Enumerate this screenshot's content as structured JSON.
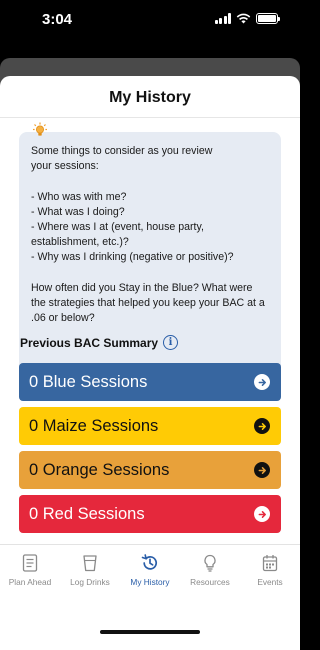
{
  "status_bar": {
    "time": "3:04"
  },
  "header": {
    "title": "My History"
  },
  "tips": {
    "text": "Some things to consider as you review\nyour sessions:\n\n- Who was with me?\n- What was I doing?\n- Where was I at (event, house party,\nestablishment, etc.)?\n- Why was I drinking (negative or positive)?\n\nHow often did you Stay in the Blue? What were\nthe strategies that helped you keep your BAC at a\n.06 or below?"
  },
  "summary": {
    "title": "Previous BAC Summary"
  },
  "sessions": [
    {
      "label": "0 Blue Sessions",
      "bg": "#3766a0",
      "fg": "#ffffff",
      "arrow_bg": "#ffffff",
      "arrow_fg": "#3766a0"
    },
    {
      "label": "0 Maize Sessions",
      "bg": "#ffcb05",
      "fg": "#111111",
      "arrow_bg": "#111111",
      "arrow_fg": "#ffcb05"
    },
    {
      "label": "0 Orange Sessions",
      "bg": "#e8a13a",
      "fg": "#111111",
      "arrow_bg": "#111111",
      "arrow_fg": "#e8a13a"
    },
    {
      "label": "0 Red Sessions",
      "bg": "#e5283c",
      "fg": "#ffffff",
      "arrow_bg": "#ffffff",
      "arrow_fg": "#e5283c"
    }
  ],
  "tabs": [
    {
      "label": "Plan Ahead",
      "icon": "checklist-icon"
    },
    {
      "label": "Log Drinks",
      "icon": "cup-icon"
    },
    {
      "label": "My History",
      "icon": "history-icon",
      "active": true
    },
    {
      "label": "Resources",
      "icon": "lightbulb-icon"
    },
    {
      "label": "Events",
      "icon": "calendar-icon"
    }
  ],
  "colors": {
    "accent": "#2a5ea8",
    "tab_inactive": "#8a8a8a",
    "card_bg": "#e6ebf3"
  }
}
